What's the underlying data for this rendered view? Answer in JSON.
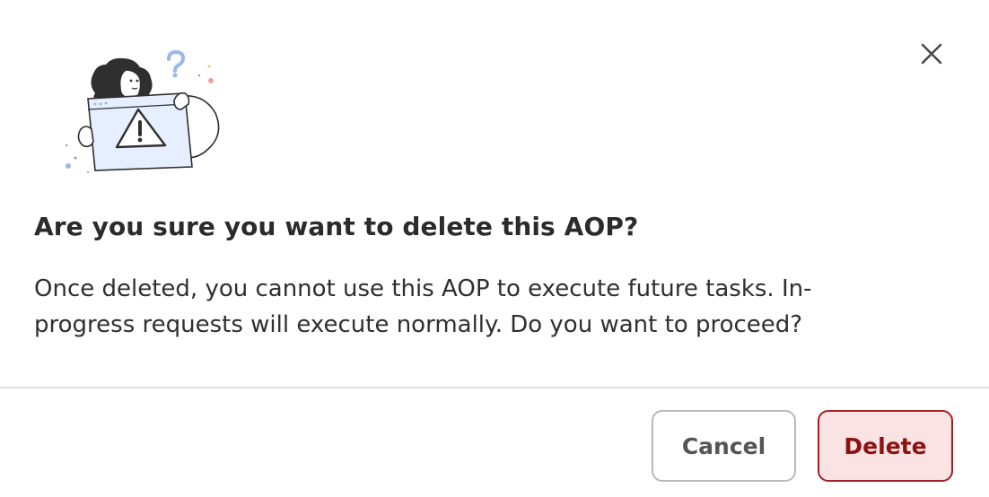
{
  "dialog": {
    "title": "Are you sure you want to delete this AOP?",
    "message": "Once deleted, you cannot use this AOP to execute future tasks. In-progress requests will execute normally. Do you want to proceed?",
    "close_icon": "close-icon",
    "illustration_icon": "warning-illustration"
  },
  "footer": {
    "cancel_label": "Cancel",
    "delete_label": "Delete"
  },
  "colors": {
    "delete_border": "#a11f24",
    "delete_background": "#fbe3e3",
    "delete_text": "#8c1212",
    "cancel_border": "#b9b9b9"
  }
}
